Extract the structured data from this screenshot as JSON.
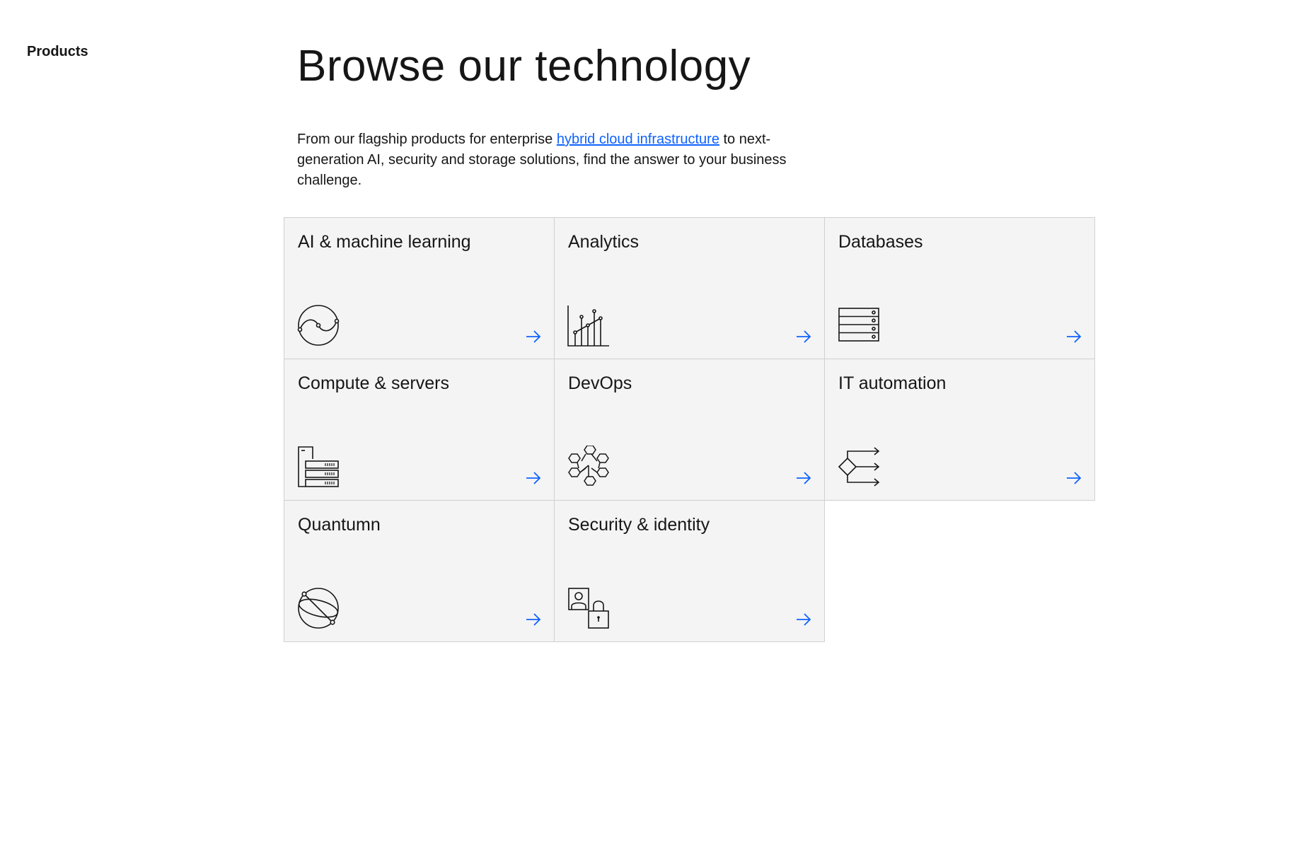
{
  "sidebar": {
    "label": "Products"
  },
  "main": {
    "title": "Browse our technology",
    "intro_before": "From our flagship products for enterprise ",
    "intro_link": "hybrid cloud infrastructure",
    "intro_after": " to next-generation AI, security and storage solutions, find the answer to your business challenge."
  },
  "tiles": [
    {
      "label": "AI & machine learning",
      "icon": "ai-cycle-icon"
    },
    {
      "label": "Analytics",
      "icon": "analytics-chart-icon"
    },
    {
      "label": "Databases",
      "icon": "database-rack-icon"
    },
    {
      "label": "Compute & servers",
      "icon": "server-rack-icon"
    },
    {
      "label": "DevOps",
      "icon": "devops-hexagons-icon"
    },
    {
      "label": "IT automation",
      "icon": "automation-flow-icon"
    },
    {
      "label": "Quantumn",
      "icon": "quantum-sphere-icon"
    },
    {
      "label": "Security & identity",
      "icon": "identity-lock-icon"
    }
  ],
  "colors": {
    "tile_background": "#f4f4f4",
    "tile_border": "#d0d0d0",
    "link": "#0f62fe",
    "arrow": "#0f62fe",
    "text": "#161616"
  }
}
